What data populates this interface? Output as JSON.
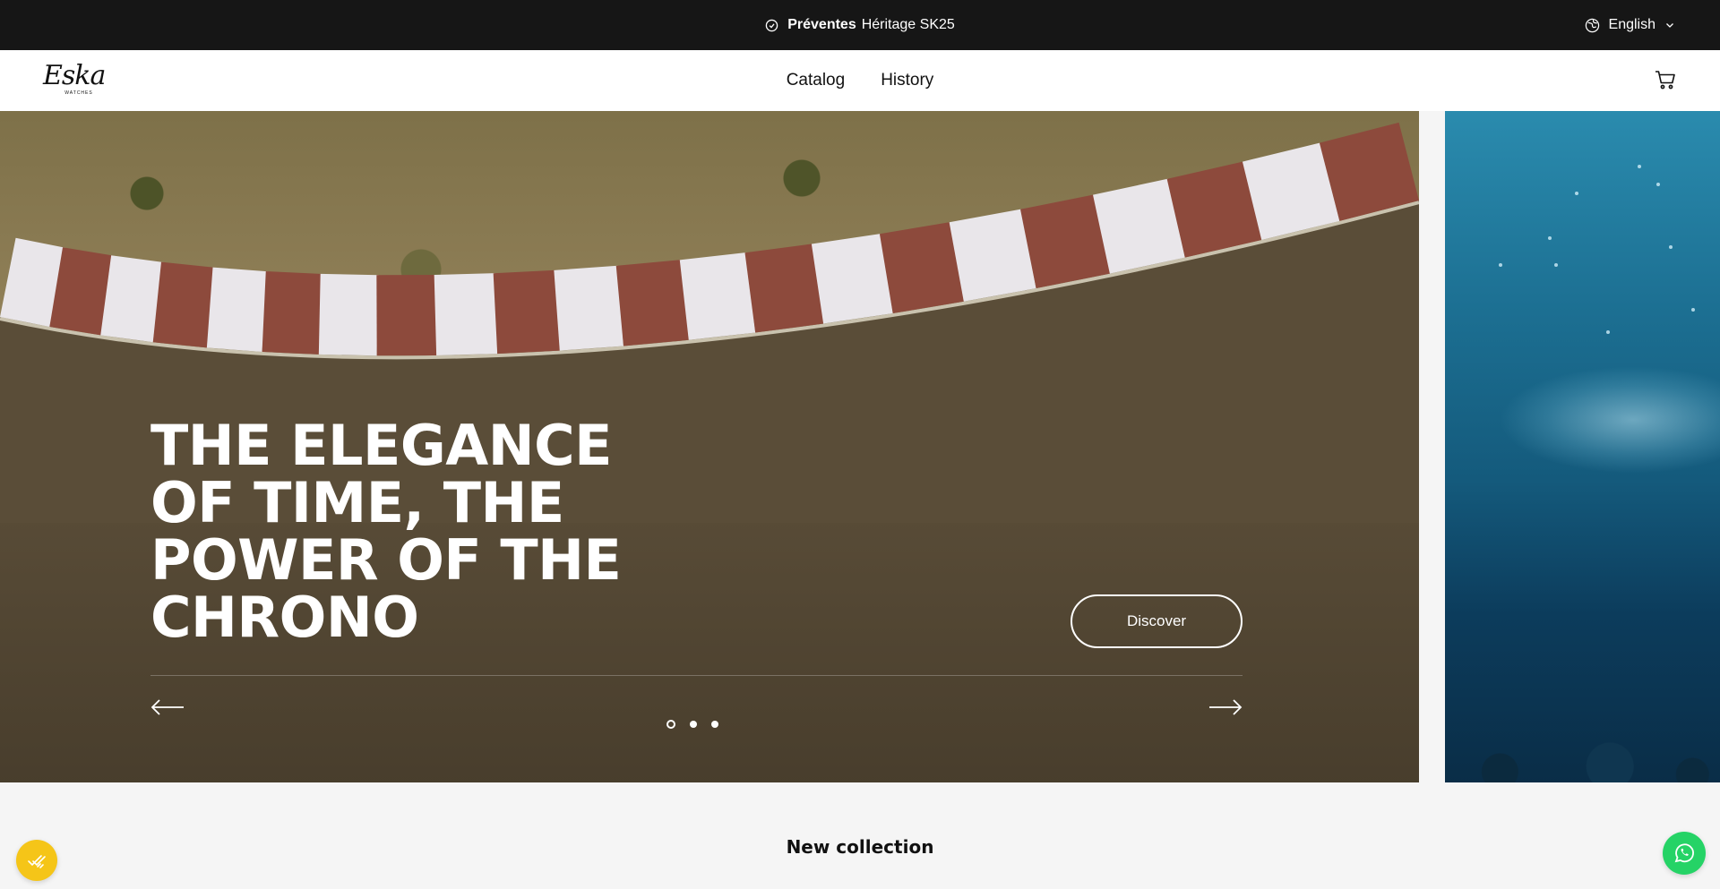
{
  "announcement": {
    "icon": "tag-icon",
    "bold_text": "Préventes",
    "text": "Héritage SK25"
  },
  "language": {
    "icon": "globe-icon",
    "label": "English",
    "dropdown_icon": "chevron-down-icon"
  },
  "header": {
    "logo_text": "Eska",
    "logo_subtext": "WATCHES",
    "nav": [
      {
        "label": "Catalog"
      },
      {
        "label": "History"
      }
    ],
    "cart_icon": "cart-icon"
  },
  "hero": {
    "title": "THE ELEGANCE OF TIME, THE POWER OF THE CHRONO",
    "cta_label": "Discover",
    "prev_icon": "arrow-left-icon",
    "next_icon": "arrow-right-icon",
    "slides_count": 3,
    "active_slide": 1
  },
  "section": {
    "title": "New collection"
  },
  "floating": {
    "cookie_icon": "cookie-consent-icon",
    "whatsapp_icon": "whatsapp-icon"
  },
  "colors": {
    "announcement_bg": "#161616",
    "cookie_button": "#f5c518",
    "whatsapp_button": "#25d366"
  }
}
